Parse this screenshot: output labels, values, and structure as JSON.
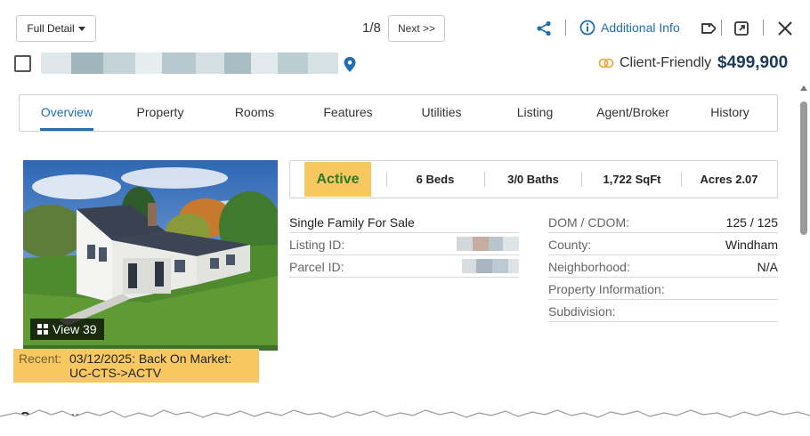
{
  "header": {
    "view_mode": "Full Detail",
    "pager": "1/8",
    "next_label": "Next >>",
    "additional_info": "Additional Info"
  },
  "listing": {
    "client_friendly": "Client-Friendly",
    "price": "$499,900"
  },
  "tabs": [
    "Overview",
    "Property",
    "Rooms",
    "Features",
    "Utilities",
    "Listing",
    "Agent/Broker",
    "History"
  ],
  "photo": {
    "view_label": "View 39"
  },
  "recent": {
    "label": "Recent:",
    "value": "03/12/2025: Back On Market: UC-CTS->ACTV"
  },
  "summary": {
    "status": "Active",
    "beds": "6 Beds",
    "baths": "3/0 Baths",
    "sqft": "1,722 SqFt",
    "acres": "Acres 2.07"
  },
  "details_left": {
    "type": "Single Family For Sale",
    "listing_id_label": "Listing ID:",
    "parcel_id_label": "Parcel ID:"
  },
  "details_right": [
    {
      "label": "DOM / CDOM:",
      "value": "125 / 125"
    },
    {
      "label": "County:",
      "value": "Windham"
    },
    {
      "label": "Neighborhood:",
      "value": "N/A"
    },
    {
      "label": "Property Information:",
      "value": ""
    },
    {
      "label": "Subdivision:",
      "value": ""
    }
  ],
  "section_heading": "Overview",
  "colors": {
    "accent": "#1f6fb2",
    "status_bg": "#f6c85f",
    "status_text": "#2d7a2d",
    "price": "#1d3a5c",
    "client_friendly_icon": "#f0a030"
  },
  "icons": {
    "share": "share-icon",
    "additional_info": "info-icon",
    "pin": "map-pin-icon",
    "open": "external-window-icon",
    "close": "close-icon",
    "tag": "tag-icon"
  }
}
